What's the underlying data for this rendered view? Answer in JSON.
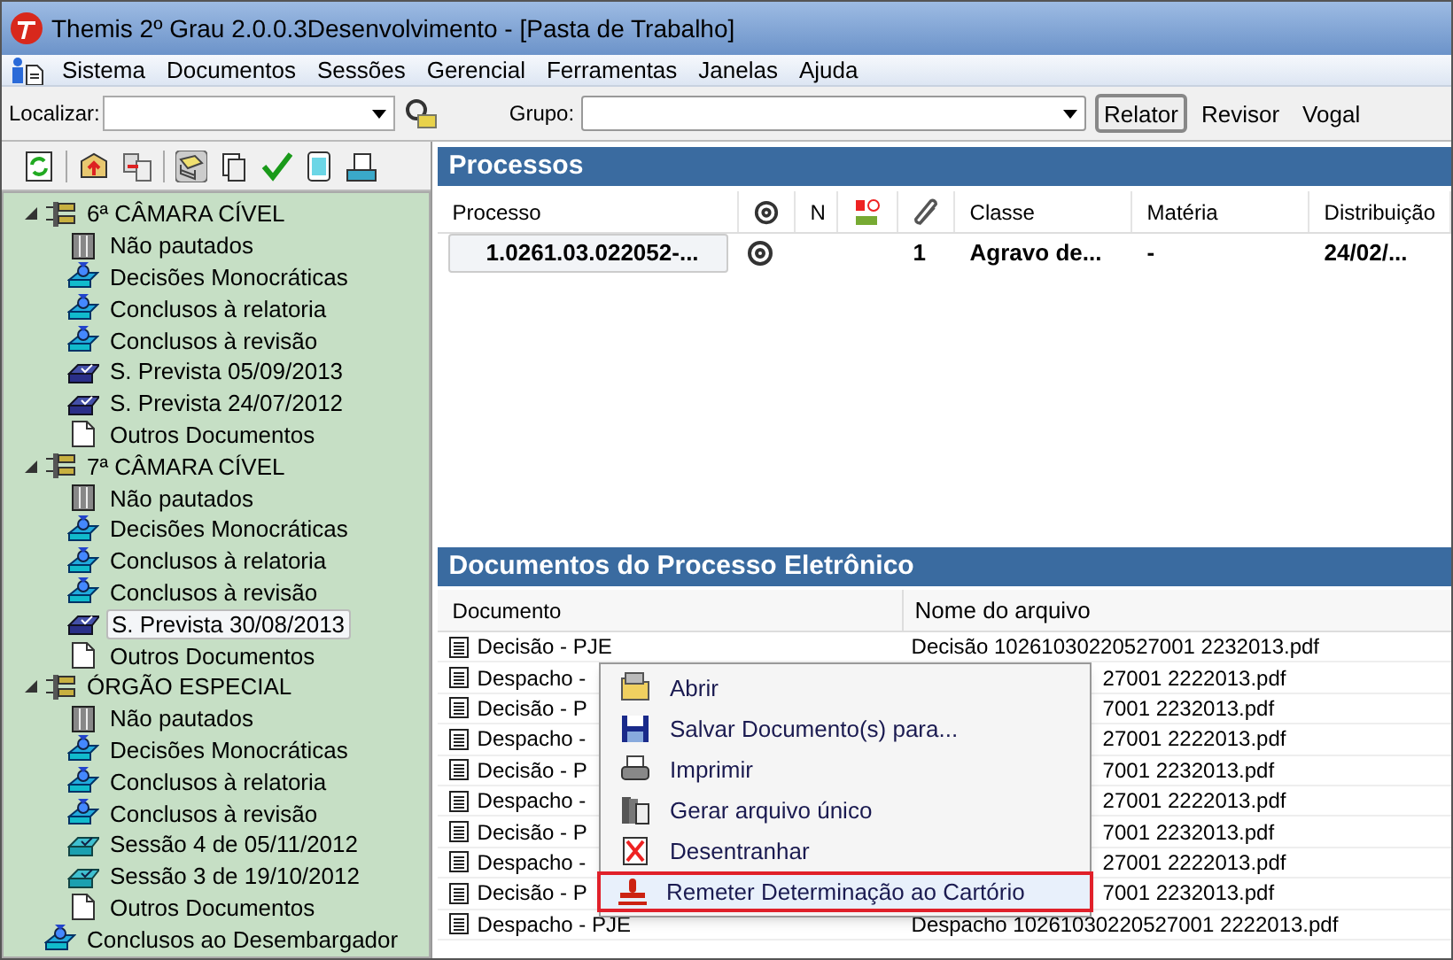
{
  "window": {
    "title": "Themis 2º Grau 2.0.0.3Desenvolvimento - [Pasta de Trabalho]"
  },
  "menu": [
    "Sistema",
    "Documentos",
    "Sessões",
    "Gerencial",
    "Ferramentas",
    "Janelas",
    "Ajuda"
  ],
  "search": {
    "label": "Localizar:"
  },
  "group": {
    "label": "Grupo:"
  },
  "roles": [
    {
      "label": "Relator",
      "selected": true
    },
    {
      "label": "Revisor",
      "selected": false
    },
    {
      "label": "Vogal",
      "selected": false
    }
  ],
  "tree": [
    {
      "kind": "group",
      "label": "6ª CÂMARA CÍVEL",
      "expanded": true,
      "selected": false,
      "children": [
        {
          "kind": "list",
          "label": "Não pautados",
          "selected": false
        },
        {
          "kind": "stack",
          "label": "Decisões Monocráticas",
          "selected": false
        },
        {
          "kind": "stack",
          "label": "Conclusos à relatoria",
          "selected": false
        },
        {
          "kind": "stack",
          "label": "Conclusos à revisão",
          "selected": false
        },
        {
          "kind": "session",
          "label": "S. Prevista 05/09/2013",
          "selected": false
        },
        {
          "kind": "session",
          "label": "S. Prevista 24/07/2012",
          "selected": false
        },
        {
          "kind": "doc",
          "label": "Outros Documentos",
          "selected": false
        }
      ]
    },
    {
      "kind": "group",
      "label": "7ª CÂMARA CÍVEL",
      "expanded": true,
      "selected": false,
      "children": [
        {
          "kind": "list",
          "label": "Não pautados",
          "selected": false
        },
        {
          "kind": "stack",
          "label": "Decisões Monocráticas",
          "selected": false
        },
        {
          "kind": "stack",
          "label": "Conclusos à relatoria",
          "selected": false
        },
        {
          "kind": "stack",
          "label": "Conclusos à revisão",
          "selected": false
        },
        {
          "kind": "session",
          "label": "S. Prevista 30/08/2013",
          "selected": true
        },
        {
          "kind": "doc",
          "label": "Outros Documentos",
          "selected": false
        }
      ]
    },
    {
      "kind": "group",
      "label": "ÓRGÃO ESPECIAL",
      "expanded": true,
      "selected": false,
      "children": [
        {
          "kind": "list",
          "label": "Não pautados",
          "selected": false
        },
        {
          "kind": "stack",
          "label": "Decisões Monocráticas",
          "selected": false
        },
        {
          "kind": "stack",
          "label": "Conclusos à relatoria",
          "selected": false
        },
        {
          "kind": "stack",
          "label": "Conclusos à revisão",
          "selected": false
        },
        {
          "kind": "held",
          "label": "Sessão 4 de 05/11/2012",
          "selected": false
        },
        {
          "kind": "held",
          "label": "Sessão 3 de 19/10/2012",
          "selected": false
        },
        {
          "kind": "doc",
          "label": "Outros Documentos",
          "selected": false
        }
      ]
    },
    {
      "kind": "stack",
      "label": "Conclusos ao Desembargador",
      "selected": false
    }
  ],
  "processes": {
    "title": "Processos",
    "columns": [
      {
        "kind": "text",
        "label": "Processo"
      },
      {
        "kind": "at"
      },
      {
        "kind": "text",
        "label": "N"
      },
      {
        "kind": "amp"
      },
      {
        "kind": "clip"
      },
      {
        "kind": "text",
        "label": "Classe"
      },
      {
        "kind": "text",
        "label": "Matéria"
      },
      {
        "kind": "text",
        "label": "Distribuição"
      }
    ],
    "rows": [
      {
        "process": "1.0261.03.022052-...",
        "electronic": true,
        "count": "1",
        "class": "Agravo de...",
        "subject": "-",
        "date": "24/02/..."
      }
    ]
  },
  "documents": {
    "title": "Documentos do Processo Eletrônico",
    "columns": [
      "Documento",
      "Nome do arquivo"
    ],
    "rows": [
      {
        "document": "Decisão - PJE",
        "file": "Decisão 10261030220527001 2232013.pdf"
      },
      {
        "document": "Despacho -",
        "file": "27001 2222013.pdf"
      },
      {
        "document": "Decisão - P",
        "file": "7001 2232013.pdf"
      },
      {
        "document": "Despacho -",
        "file": "27001 2222013.pdf"
      },
      {
        "document": "Decisão - P",
        "file": "7001 2232013.pdf"
      },
      {
        "document": "Despacho -",
        "file": "27001 2222013.pdf"
      },
      {
        "document": "Decisão - P",
        "file": "7001 2232013.pdf"
      },
      {
        "document": "Despacho -",
        "file": "27001 2222013.pdf"
      },
      {
        "document": "Decisão - P",
        "file": "7001 2232013.pdf"
      },
      {
        "document": "Despacho - PJE",
        "file": "Despacho 10261030220527001 2222013.pdf"
      }
    ]
  },
  "context_menu": [
    {
      "kind": "open",
      "label": "Abrir",
      "highlighted": false
    },
    {
      "kind": "save",
      "label": "Salvar Documento(s) para...",
      "highlighted": false
    },
    {
      "kind": "print",
      "label": "Imprimir",
      "highlighted": false
    },
    {
      "kind": "merge",
      "label": "Gerar arquivo único",
      "highlighted": false
    },
    {
      "kind": "remove",
      "label": "Desentranhar",
      "highlighted": false
    },
    {
      "kind": "stamp",
      "label": "Remeter Determinação ao Cartório",
      "highlighted": true
    }
  ]
}
